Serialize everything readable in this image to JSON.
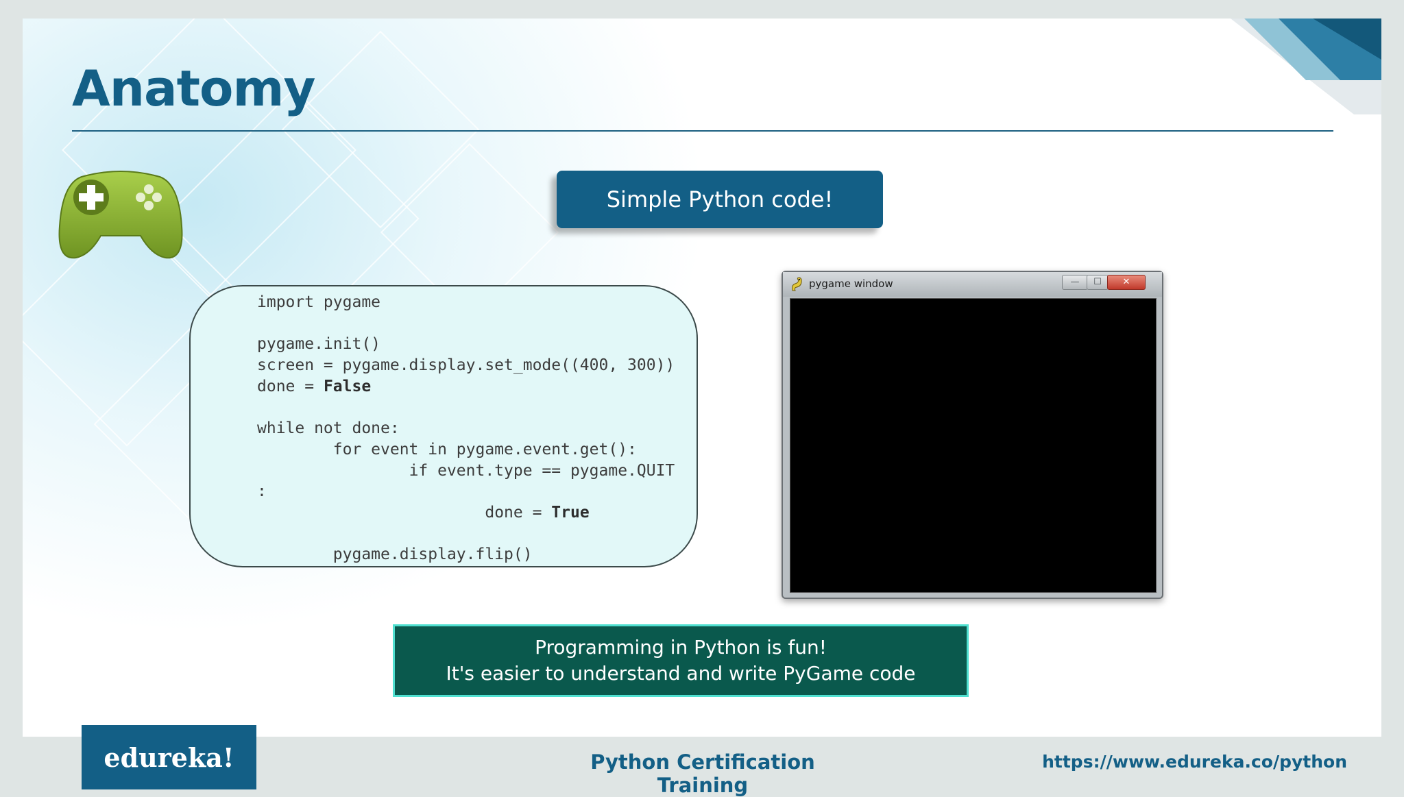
{
  "slide": {
    "title": "Anatomy",
    "banner": "Simple Python code!",
    "code_lines": [
      {
        "indent": "",
        "text": "import pygame",
        "kw": ""
      },
      {
        "indent": "",
        "text": "",
        "kw": ""
      },
      {
        "indent": "",
        "text": "pygame.init()",
        "kw": ""
      },
      {
        "indent": "",
        "text": "screen = pygame.display.set_mode((400, 300))",
        "kw": ""
      },
      {
        "indent": "",
        "text": "done = ",
        "kw": "False"
      },
      {
        "indent": "",
        "text": "",
        "kw": ""
      },
      {
        "indent": "",
        "text": "while not done:",
        "kw": ""
      },
      {
        "indent": "        ",
        "text": "for event in pygame.event.get():",
        "kw": ""
      },
      {
        "indent": "                ",
        "text": "if event.type == pygame.QUIT",
        "kw": ""
      },
      {
        "indent": "",
        "text": ":",
        "kw": ""
      },
      {
        "indent": "                        ",
        "text": "done = ",
        "kw": "True"
      },
      {
        "indent": "",
        "text": "",
        "kw": ""
      },
      {
        "indent": "        ",
        "text": "pygame.display.flip()",
        "kw": ""
      }
    ],
    "window_title": "pygame window",
    "window_buttons": {
      "minimize": "—",
      "maximize": "☐",
      "close": "✕"
    },
    "note_lines": [
      "Programming in Python is fun!",
      "It's easier to understand and write PyGame code"
    ]
  },
  "footer": {
    "brand": "edureka!",
    "course": "Python Certification Training",
    "url": "https://www.edureka.co/python"
  },
  "colors": {
    "brand": "#135f86",
    "note_bg": "#0a594d",
    "note_border": "#4fe0d0",
    "code_bg": "#e2f8f8",
    "gamepad_green": "#8fb83a"
  },
  "icons": [
    "gamepad-icon",
    "pygame-snake-icon",
    "minimize-icon",
    "maximize-icon",
    "close-icon"
  ]
}
